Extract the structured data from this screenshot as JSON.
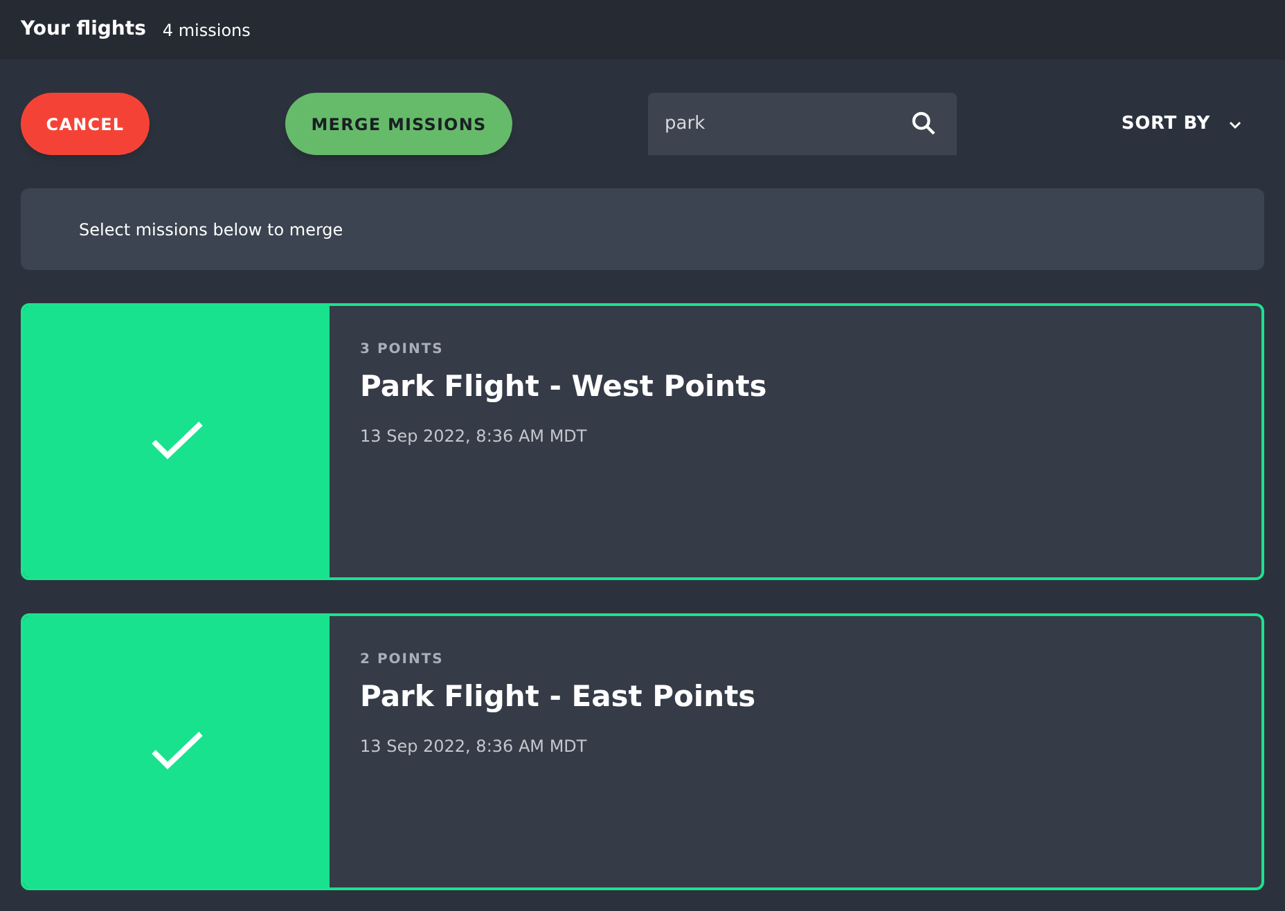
{
  "header": {
    "title": "Your flights",
    "count": "4 missions"
  },
  "toolbar": {
    "cancel": "CANCEL",
    "merge": "MERGE MISSIONS",
    "search": {
      "value": "park"
    },
    "sort": "SORT BY"
  },
  "notice": "Select missions below to merge",
  "missions": [
    {
      "points": "3 POINTS",
      "title": "Park Flight - West Points",
      "date": "13 Sep 2022, 8:36 AM MDT",
      "selected": true
    },
    {
      "points": "2 POINTS",
      "title": "Park Flight - East Points",
      "date": "13 Sep 2022, 8:36 AM MDT",
      "selected": true
    }
  ]
}
